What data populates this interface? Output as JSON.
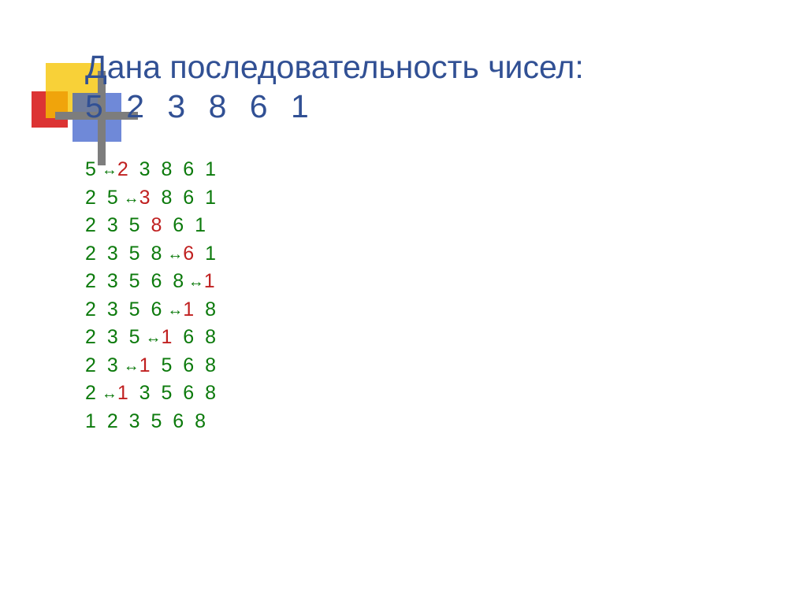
{
  "title": {
    "line1": "Дана последовательность чисел:",
    "line2": "5  2  3  8  6  1"
  },
  "arrow": "↔",
  "rows": [
    {
      "cells": [
        {
          "v": "5"
        },
        {
          "t": "arrow"
        },
        {
          "v": "2",
          "c": "r"
        },
        {
          "t": "sp2"
        },
        {
          "v": "3"
        },
        {
          "t": "sp2"
        },
        {
          "v": "8"
        },
        {
          "t": "sp2"
        },
        {
          "v": "6"
        },
        {
          "t": "sp2"
        },
        {
          "v": "1"
        }
      ]
    },
    {
      "cells": [
        {
          "v": "2"
        },
        {
          "t": "sp2"
        },
        {
          "v": "5"
        },
        {
          "t": "arrow"
        },
        {
          "v": "3",
          "c": "r"
        },
        {
          "t": "sp2"
        },
        {
          "v": "8"
        },
        {
          "t": "sp2"
        },
        {
          "v": "6"
        },
        {
          "t": "sp2"
        },
        {
          "v": "1"
        }
      ]
    },
    {
      "cells": [
        {
          "v": "2"
        },
        {
          "t": "sp2"
        },
        {
          "v": "3"
        },
        {
          "t": "sp2"
        },
        {
          "v": "5"
        },
        {
          "t": "sp2"
        },
        {
          "v": "8",
          "c": "r"
        },
        {
          "t": "sp2"
        },
        {
          "v": "6"
        },
        {
          "t": "sp2"
        },
        {
          "v": "1"
        }
      ]
    },
    {
      "cells": [
        {
          "v": "2"
        },
        {
          "t": "sp2"
        },
        {
          "v": "3"
        },
        {
          "t": "sp2"
        },
        {
          "v": "5"
        },
        {
          "t": "sp2"
        },
        {
          "v": "8"
        },
        {
          "t": "arrow"
        },
        {
          "v": "6",
          "c": "r"
        },
        {
          "t": "sp2"
        },
        {
          "v": "1"
        }
      ]
    },
    {
      "cells": [
        {
          "v": "2"
        },
        {
          "t": "sp2"
        },
        {
          "v": "3"
        },
        {
          "t": "sp2"
        },
        {
          "v": "5"
        },
        {
          "t": "sp2"
        },
        {
          "v": "6"
        },
        {
          "t": "sp2"
        },
        {
          "v": "8"
        },
        {
          "t": "arrow-tight"
        },
        {
          "v": "1",
          "c": "r"
        }
      ]
    },
    {
      "cells": [
        {
          "v": "2"
        },
        {
          "t": "sp2"
        },
        {
          "v": "3"
        },
        {
          "t": "sp2"
        },
        {
          "v": "5"
        },
        {
          "t": "sp2"
        },
        {
          "v": "6"
        },
        {
          "t": "arrow"
        },
        {
          "v": "1",
          "c": "r"
        },
        {
          "t": "sp2"
        },
        {
          "v": "8"
        }
      ]
    },
    {
      "cells": [
        {
          "v": "2"
        },
        {
          "t": "sp2"
        },
        {
          "v": "3"
        },
        {
          "t": "sp2"
        },
        {
          "v": "5"
        },
        {
          "t": "arrow"
        },
        {
          "v": "1",
          "c": "r"
        },
        {
          "t": "sp2"
        },
        {
          "v": "6"
        },
        {
          "t": "sp2"
        },
        {
          "v": "8"
        }
      ]
    },
    {
      "cells": [
        {
          "v": "2"
        },
        {
          "t": "sp2"
        },
        {
          "v": "3"
        },
        {
          "t": "arrow"
        },
        {
          "v": "1",
          "c": "r"
        },
        {
          "t": "sp2"
        },
        {
          "v": "5"
        },
        {
          "t": "sp2"
        },
        {
          "v": "6"
        },
        {
          "t": "sp2"
        },
        {
          "v": "8"
        }
      ]
    },
    {
      "cells": [
        {
          "v": "2"
        },
        {
          "t": "arrow"
        },
        {
          "v": "1",
          "c": "r"
        },
        {
          "t": "sp2"
        },
        {
          "v": "3"
        },
        {
          "t": "sp2"
        },
        {
          "v": "5"
        },
        {
          "t": "sp2"
        },
        {
          "v": "6"
        },
        {
          "t": "sp2"
        },
        {
          "v": "8"
        }
      ]
    },
    {
      "cells": [
        {
          "v": "1"
        },
        {
          "t": "sp2"
        },
        {
          "v": "2"
        },
        {
          "t": "sp2"
        },
        {
          "v": "3"
        },
        {
          "t": "sp2"
        },
        {
          "v": "5"
        },
        {
          "t": "sp2"
        },
        {
          "v": "6"
        },
        {
          "t": "sp2"
        },
        {
          "v": "8"
        }
      ]
    }
  ]
}
